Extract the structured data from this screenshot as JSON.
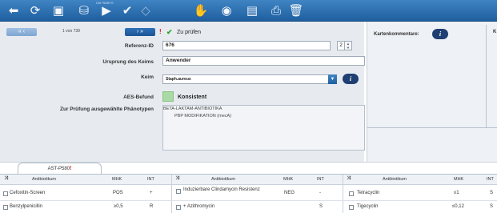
{
  "toolbar": {
    "caption": "Ctrl+Shift+S",
    "icons": [
      "back-arrow",
      "refresh",
      "patient",
      "database",
      "play",
      "check",
      "eraser",
      "hand",
      "eye-search",
      "save",
      "print",
      "delete"
    ]
  },
  "pager": {
    "prev": "«  ‹",
    "next": "›  »",
    "count": "1 von 739"
  },
  "status": {
    "mark": "!",
    "check": "✔",
    "text": "Zu prüfen"
  },
  "form": {
    "ref_label": "Referenz-ID",
    "ref_value": "676",
    "ref_stepper": "2",
    "origin_label": "Ursprung des Keims",
    "origin_value": "Anwender",
    "germ_label": "Keim",
    "germ_value": "Staph.aureus",
    "aes_label": "AES-Befund",
    "aes_value": "Konsistent",
    "pheno_label": "Zur Prüfung ausgewählte Phänotypen",
    "pheno_lines": [
      "BETA-LAKTAM-ANTIBIOTIKA",
      "PBP MODIFIKATION (mecA)"
    ]
  },
  "right_panel": {
    "comment_label": "Kartenkommentare:",
    "cut_label": "K"
  },
  "tab": {
    "label": "AST-P580",
    "mark": "!"
  },
  "table": {
    "groups": [
      {
        "headers": [
          "Antibiotikum",
          "MHK",
          "INT"
        ],
        "rows": [
          {
            "name": "Cefoxitin-Screen",
            "mhk": "POS",
            "int": "+"
          },
          {
            "name": "Benzylpenicillin",
            "mhk": "≥0,5",
            "int": "R"
          }
        ]
      },
      {
        "headers": [
          "Antibiotikum",
          "MHK",
          "INT"
        ],
        "rows": [
          {
            "name": "Induzierbare Clindamycin Resistenz",
            "mhk": "NEG",
            "int": "-"
          },
          {
            "name": "+ Azithromycin",
            "mhk": "",
            "int": "S"
          }
        ]
      },
      {
        "headers": [
          "Antibiotikum",
          "MHK",
          "INT"
        ],
        "rows": [
          {
            "name": "Tetracyclin",
            "mhk": "≤1",
            "int": "S"
          },
          {
            "name": "Tigecyclin",
            "mhk": "≤0,12",
            "int": "S"
          }
        ]
      }
    ]
  },
  "colors": {
    "toolbar": "#2a6fb2",
    "form_bg": "#e7ebf0",
    "status_check": "#2fa22a",
    "required_mark": "#e01818",
    "aes_indicator": "#a9d9a5"
  }
}
